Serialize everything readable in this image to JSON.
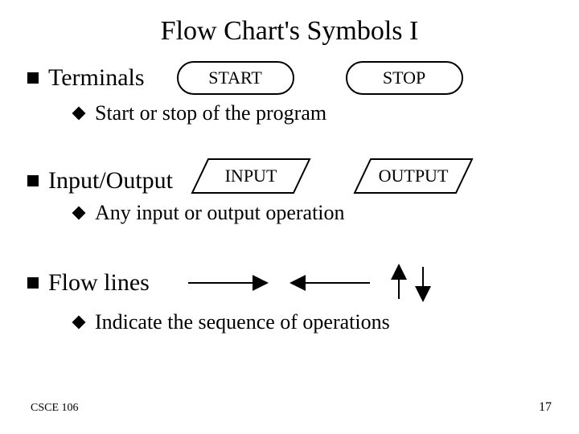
{
  "title": "Flow Chart's Symbols I",
  "sections": {
    "terminals": {
      "heading": "Terminals",
      "desc": "Start or stop of the program",
      "start_label": "START",
      "stop_label": "STOP"
    },
    "io": {
      "heading": "Input/Output",
      "desc": "Any input or output operation",
      "input_label": "INPUT",
      "output_label": "OUTPUT"
    },
    "flow": {
      "heading": "Flow lines",
      "desc": "Indicate the sequence of operations"
    }
  },
  "footer": {
    "course": "CSCE 106",
    "page": "17"
  }
}
